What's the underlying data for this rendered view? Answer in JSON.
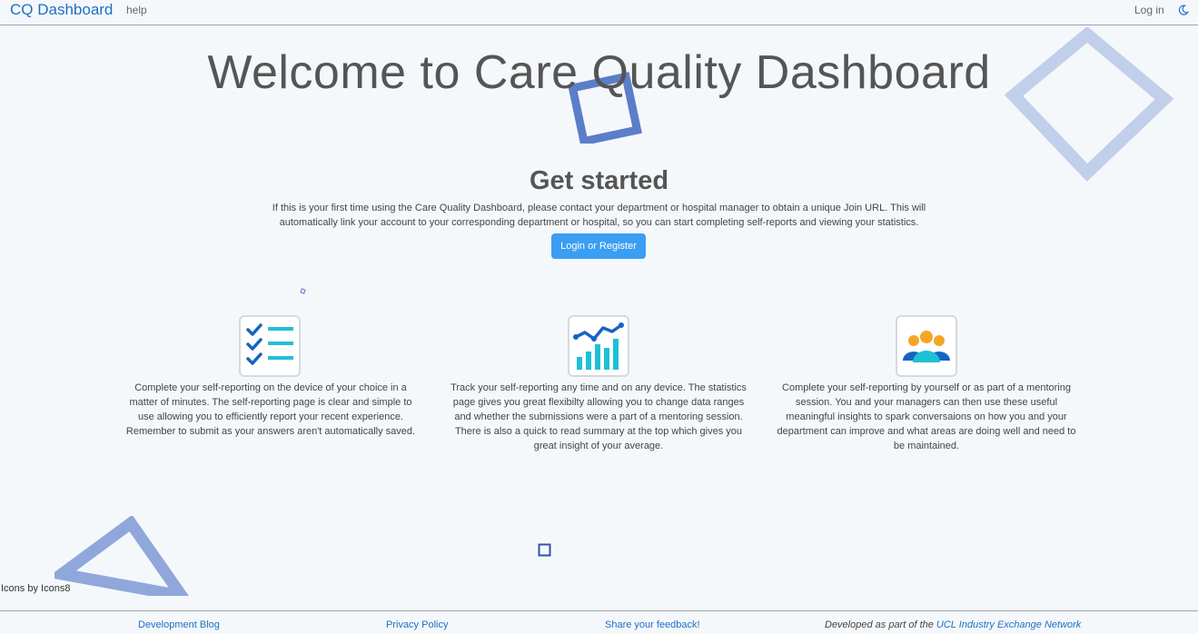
{
  "navbar": {
    "brand": "CQ Dashboard",
    "help": "help",
    "login": "Log in",
    "theme_icon": "moon-icon"
  },
  "hero": {
    "title": "Welcome to Care Quality Dashboard",
    "subtitle": "Get started",
    "intro": "If this is your first time using the Care Quality Dashboard, please contact your department or hospital manager to obtain a unique Join URL. This will automatically link your account to your corresponding department or hospital, so you can start completing self-reports and viewing your statistics.",
    "button": "Login or Register"
  },
  "features": [
    {
      "icon": "checklist-icon",
      "text": "Complete your self-reporting on the device of your choice in a matter of minutes. The self-reporting page is clear and simple to use allowing you to efficiently report your recent experience. Remember to submit as your answers aren't automatically saved."
    },
    {
      "icon": "statistics-chart-icon",
      "text": "Track your self-reporting any time and on any device. The statistics page gives you great flexibilty allowing you to change data ranges and whether the submissions were a part of a mentoring session. There is also a quick to read summary at the top which gives you great insight of your average."
    },
    {
      "icon": "team-icon",
      "text": "Complete your self-reporting by yourself or as part of a mentoring session. You and your managers can then use these useful meaningful insights to spark conversaions on how you and your department can improve and what areas are doing well and need to be maintained."
    }
  ],
  "credit": "Icons by Icons8",
  "footer": {
    "blog": "Development Blog",
    "privacy": "Privacy Policy",
    "feedback": "Share your feedback!",
    "developed_prefix": "Developed as part of the ",
    "developed_link": "UCL Industry Exchange Network"
  },
  "colors": {
    "brand": "#1d6fc4",
    "button": "#3a9ef2",
    "deco_dark": "#4a6fc0",
    "deco_light": "#b8c8e8"
  }
}
